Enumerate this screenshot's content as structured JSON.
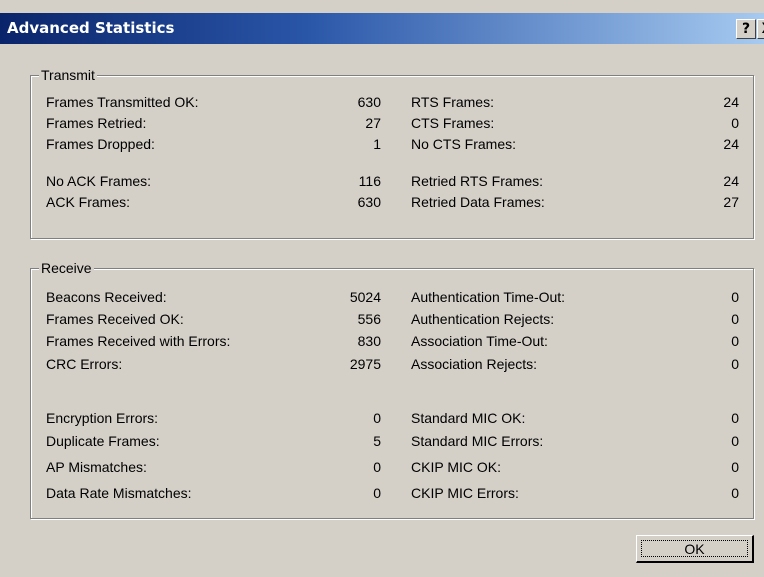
{
  "window": {
    "title": "Advanced Statistics",
    "help_label": "?",
    "close_label": "X"
  },
  "transmit": {
    "legend": "Transmit",
    "left": [
      {
        "label": "Frames Transmitted OK:",
        "value": "630"
      },
      {
        "label": "Frames Retried:",
        "value": "27"
      },
      {
        "label": "Frames Dropped:",
        "value": "1"
      },
      {
        "label": "No ACK Frames:",
        "value": "116"
      },
      {
        "label": "ACK Frames:",
        "value": "630"
      }
    ],
    "right": [
      {
        "label": "RTS Frames:",
        "value": "24"
      },
      {
        "label": "CTS Frames:",
        "value": "0"
      },
      {
        "label": "No CTS Frames:",
        "value": "24"
      },
      {
        "label": "Retried RTS Frames:",
        "value": "24"
      },
      {
        "label": "Retried Data Frames:",
        "value": "27"
      }
    ]
  },
  "receive": {
    "legend": "Receive",
    "left": [
      {
        "label": "Beacons Received:",
        "value": "5024"
      },
      {
        "label": "Frames Received OK:",
        "value": "556"
      },
      {
        "label": "Frames Received with Errors:",
        "value": "830"
      },
      {
        "label": "CRC Errors:",
        "value": "2975"
      },
      {
        "label": "Encryption Errors:",
        "value": "0"
      },
      {
        "label": "Duplicate Frames:",
        "value": "5"
      },
      {
        "label": "AP Mismatches:",
        "value": "0"
      },
      {
        "label": "Data Rate Mismatches:",
        "value": "0"
      }
    ],
    "right": [
      {
        "label": "Authentication Time-Out:",
        "value": "0"
      },
      {
        "label": "Authentication Rejects:",
        "value": "0"
      },
      {
        "label": "Association Time-Out:",
        "value": "0"
      },
      {
        "label": "Association Rejects:",
        "value": "0"
      },
      {
        "label": "Standard MIC OK:",
        "value": "0"
      },
      {
        "label": "Standard MIC Errors:",
        "value": "0"
      },
      {
        "label": "CKIP MIC OK:",
        "value": "0"
      },
      {
        "label": "CKIP MIC Errors:",
        "value": "0"
      }
    ]
  },
  "buttons": {
    "ok_label": "OK"
  }
}
